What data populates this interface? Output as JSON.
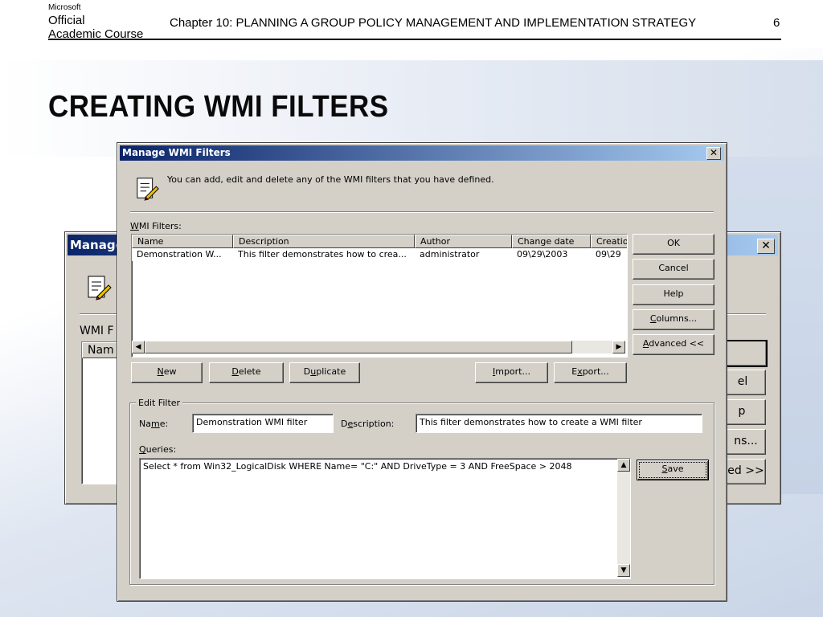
{
  "slide": {
    "logo_line1": "Microsoft",
    "logo_line2": "Official",
    "logo_line3": "Academic Course",
    "header_title": "Chapter 10: PLANNING A GROUP POLICY MANAGEMENT AND IMPLEMENTATION STRATEGY",
    "page_number": "6",
    "title": "CREATING WMI FILTERS"
  },
  "back_dialog": {
    "title": "Manage",
    "wmi_label": "WMI F",
    "col_name": "Nam",
    "btn_cancel_partial": "el",
    "btn_help_partial": "p",
    "btn_columns_partial": "ns...",
    "btn_advanced_partial": "ed >>"
  },
  "dialog": {
    "title": "Manage WMI Filters",
    "intro_text": "You can add, edit and delete any of the WMI filters that you have defined.",
    "wmi_filters_label": "WMI Filters:",
    "columns": [
      "Name",
      "Description",
      "Author",
      "Change date",
      "Creatio"
    ],
    "rows": [
      {
        "name": "Demonstration W...",
        "description": "This filter demonstrates how to crea...",
        "author": "administrator",
        "change_date": "09\\29\\2003",
        "creation": "09\\29"
      }
    ],
    "buttons": {
      "ok": "OK",
      "cancel": "Cancel",
      "help": "Help",
      "columns": "Columns...",
      "advanced": "Advanced <<",
      "new": "New",
      "delete": "Delete",
      "duplicate": "Duplicate",
      "import": "Import...",
      "export": "Export...",
      "save": "Save"
    },
    "edit_filter": {
      "group_label": "Edit Filter",
      "name_label": "Name:",
      "name_value": "Demonstration WMI filter",
      "description_label": "Description:",
      "description_value": "This filter demonstrates how to create a WMI filter",
      "queries_label": "Queries:",
      "query_value": "Select * from Win32_LogicalDisk WHERE Name= \"C:\" AND DriveType = 3 AND FreeSpace > 2048"
    }
  }
}
